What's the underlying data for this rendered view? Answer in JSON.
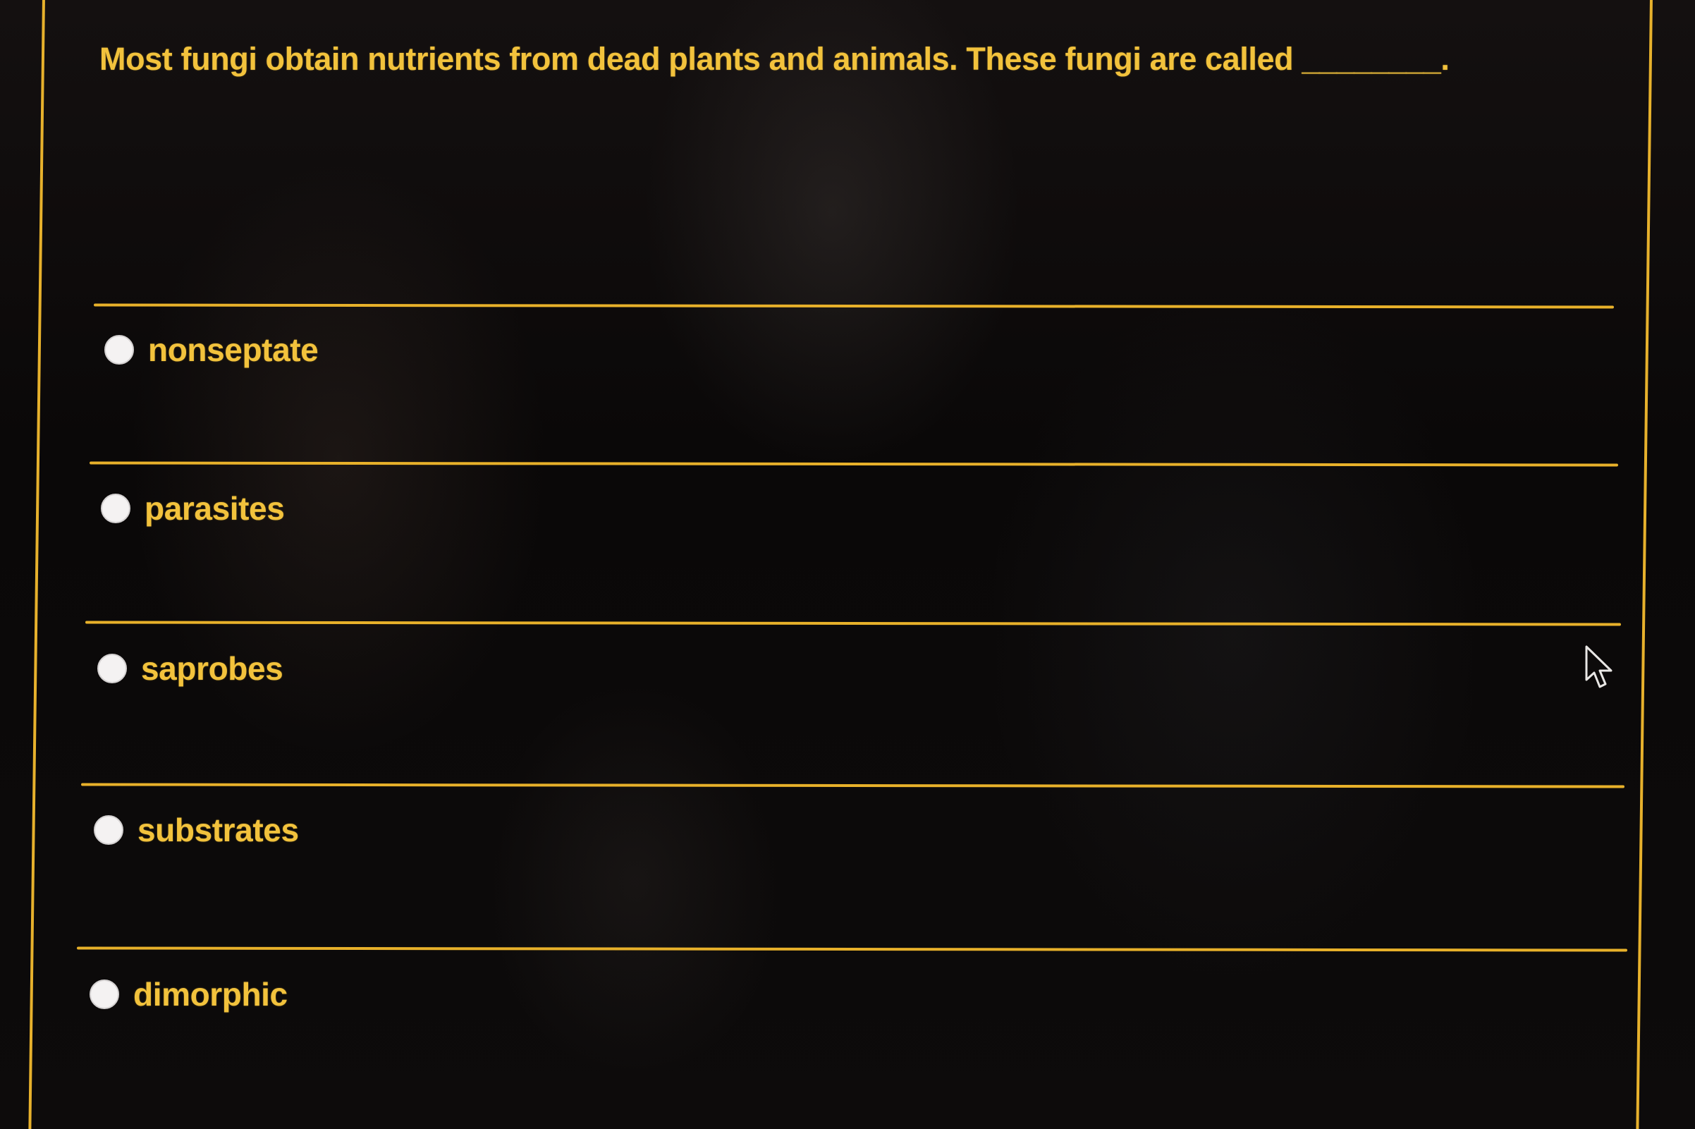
{
  "question": {
    "text": "Most fungi obtain nutrients from dead plants and animals. These fungi are called ________."
  },
  "options": [
    {
      "label": "nonseptate",
      "selected": false
    },
    {
      "label": "parasites",
      "selected": false
    },
    {
      "label": "saprobes",
      "selected": false
    },
    {
      "label": "substrates",
      "selected": false
    },
    {
      "label": "dimorphic",
      "selected": false
    }
  ],
  "cursor_icon": "arrow-pointer-icon",
  "colors": {
    "accent": "#e8b12a",
    "text": "#f2c23c",
    "background": "#0b0909",
    "radio": "#f4f2f2"
  }
}
